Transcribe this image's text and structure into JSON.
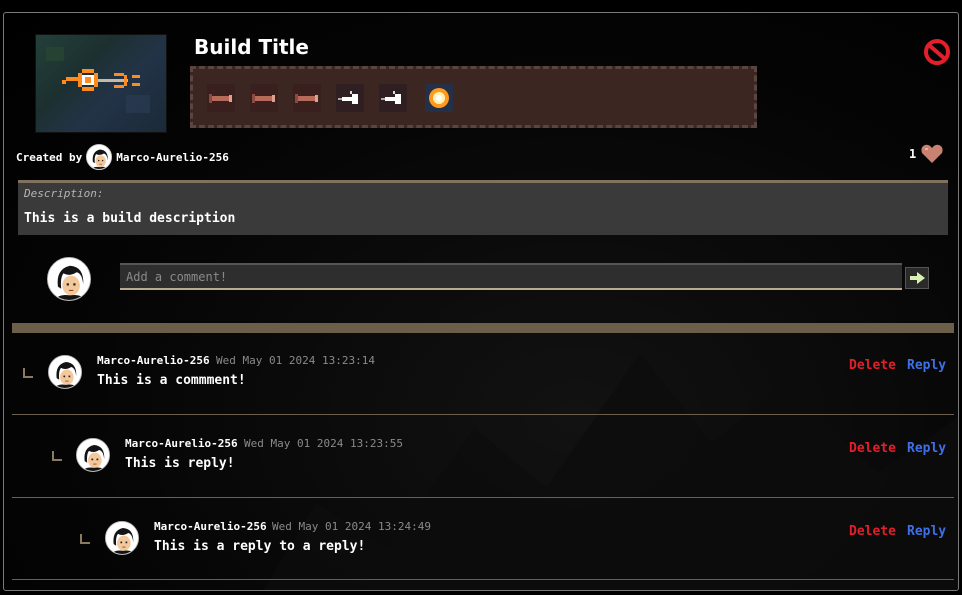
{
  "build": {
    "title": "Build Title",
    "created_by_label": "Created by",
    "author": "Marco-Aurelio-256",
    "likes": "1",
    "weapons": [
      {
        "icon": "missile-icon"
      },
      {
        "icon": "missile-icon"
      },
      {
        "icon": "missile-icon"
      },
      {
        "icon": "thruster-icon"
      },
      {
        "icon": "thruster-icon"
      },
      {
        "icon": "energy-orb-icon"
      }
    ]
  },
  "description": {
    "label": "Description:",
    "text": "This is a build description"
  },
  "comment_box": {
    "placeholder": "Add a comment!"
  },
  "comments": [
    {
      "author": "Marco-Aurelio-256",
      "date": "Wed May 01 2024 13:23:14",
      "text": "This is a commment!",
      "delete_label": "Delete",
      "reply_label": "Reply"
    },
    {
      "author": "Marco-Aurelio-256",
      "date": "Wed May 01 2024 13:23:55",
      "text": "This is reply!",
      "delete_label": "Delete",
      "reply_label": "Reply"
    },
    {
      "author": "Marco-Aurelio-256",
      "date": "Wed May 01 2024 13:24:49",
      "text": "This is a reply to a reply!",
      "delete_label": "Delete",
      "reply_label": "Reply"
    }
  ],
  "colors": {
    "delete": "#e21f2a",
    "reply": "#3f6fe8",
    "accent": "#6b5f4a"
  }
}
